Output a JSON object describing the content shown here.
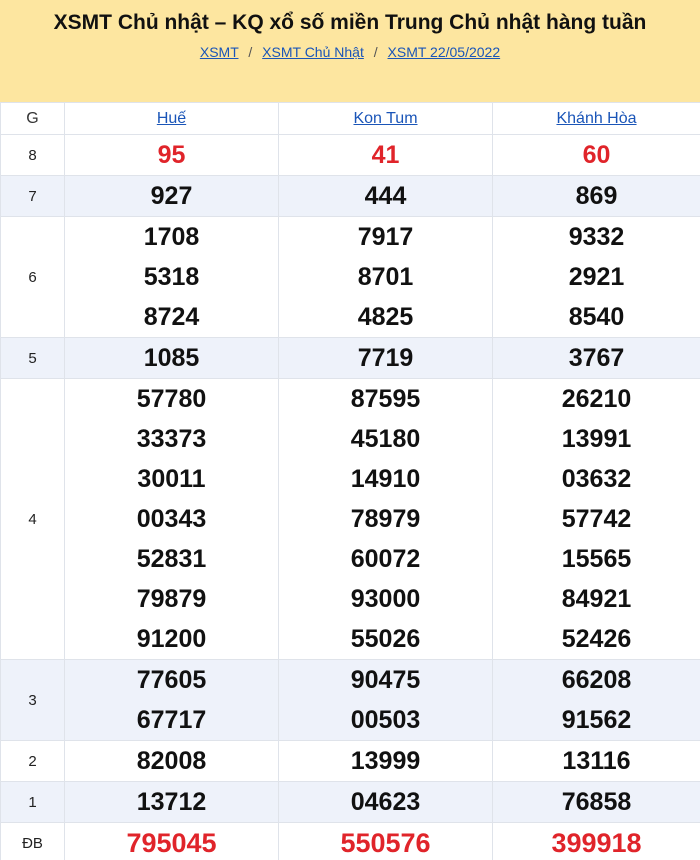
{
  "header": {
    "title": "XSMT Chủ nhật – KQ xổ số miền Trung Chủ nhật hàng tuần",
    "breadcrumb": [
      "XSMT",
      "XSMT Chủ Nhật",
      "XSMT 22/05/2022"
    ],
    "separator": "/"
  },
  "table": {
    "corner": "G",
    "provinces": [
      "Huế",
      "Kon Tum",
      "Khánh Hòa"
    ],
    "rows": [
      {
        "label": "8",
        "style": "red",
        "alt": false,
        "cols": [
          [
            "95"
          ],
          [
            "41"
          ],
          [
            "60"
          ]
        ]
      },
      {
        "label": "7",
        "style": "normal",
        "alt": true,
        "cols": [
          [
            "927"
          ],
          [
            "444"
          ],
          [
            "869"
          ]
        ]
      },
      {
        "label": "6",
        "style": "normal",
        "alt": false,
        "cols": [
          [
            "1708",
            "5318",
            "8724"
          ],
          [
            "7917",
            "8701",
            "4825"
          ],
          [
            "9332",
            "2921",
            "8540"
          ]
        ]
      },
      {
        "label": "5",
        "style": "normal",
        "alt": true,
        "cols": [
          [
            "1085"
          ],
          [
            "7719"
          ],
          [
            "3767"
          ]
        ]
      },
      {
        "label": "4",
        "style": "normal",
        "alt": false,
        "cols": [
          [
            "57780",
            "33373",
            "30011",
            "00343",
            "52831",
            "79879",
            "91200"
          ],
          [
            "87595",
            "45180",
            "14910",
            "78979",
            "60072",
            "93000",
            "55026"
          ],
          [
            "26210",
            "13991",
            "03632",
            "57742",
            "15565",
            "84921",
            "52426"
          ]
        ]
      },
      {
        "label": "3",
        "style": "normal",
        "alt": true,
        "cols": [
          [
            "77605",
            "67717"
          ],
          [
            "90475",
            "00503"
          ],
          [
            "66208",
            "91562"
          ]
        ]
      },
      {
        "label": "2",
        "style": "normal",
        "alt": false,
        "cols": [
          [
            "82008"
          ],
          [
            "13999"
          ],
          [
            "13116"
          ]
        ]
      },
      {
        "label": "1",
        "style": "normal",
        "alt": true,
        "cols": [
          [
            "13712"
          ],
          [
            "04623"
          ],
          [
            "76858"
          ]
        ]
      },
      {
        "label": "ĐB",
        "style": "red-big",
        "alt": false,
        "cols": [
          [
            "795045"
          ],
          [
            "550576"
          ],
          [
            "399918"
          ]
        ]
      }
    ]
  },
  "colors": {
    "header_bg": "#fde6a0",
    "link": "#1a55b8",
    "prize_red": "#e0242a",
    "alt_row_bg": "#eef2fa"
  }
}
